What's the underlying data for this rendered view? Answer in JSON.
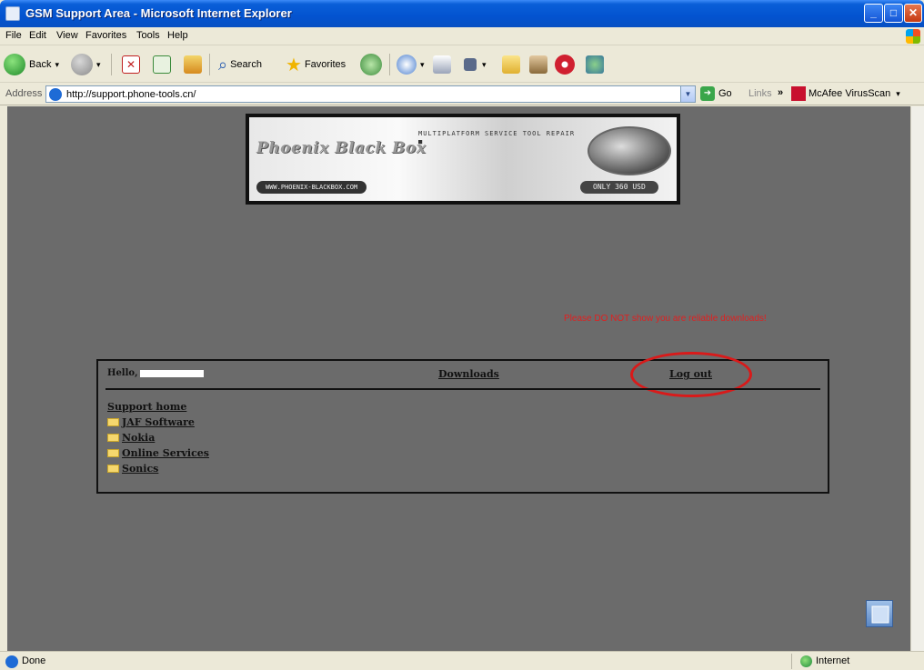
{
  "window": {
    "title": "GSM Support Area - Microsoft Internet Explorer"
  },
  "menu": [
    "File",
    "Edit",
    "View",
    "Favorites",
    "Tools",
    "Help"
  ],
  "toolbar": {
    "back": "Back",
    "search": "Search",
    "favorites": "Favorites"
  },
  "address": {
    "label": "Address",
    "url": "http://support.phone-tools.cn/",
    "go": "Go",
    "links": "Links",
    "links_chevron": "»",
    "mcafee": "McAfee VirusScan"
  },
  "banner": {
    "logo": "Phoenix Black Box",
    "tagline": "MULTIPLATFORM SERVICE TOOL REPAIR ■",
    "url": "WWW.PHOENIX-BLACKBOX.COM",
    "price": "ONLY 360 USD"
  },
  "notice": "Please DO NOT show you are reliable downloads!",
  "main": {
    "hello": "Hello,",
    "downloads": "Downloads",
    "logout": "Log out",
    "nav": {
      "support_home": "Support home",
      "items": [
        "JAF Software",
        "Nokia",
        "Online Services",
        "Sonics"
      ]
    }
  },
  "status": {
    "text": "Done",
    "zone": "Internet"
  },
  "colors": {
    "page_bg": "#6b6b6b",
    "highlight_circle": "#d91a1a",
    "notice": "#e02020"
  }
}
